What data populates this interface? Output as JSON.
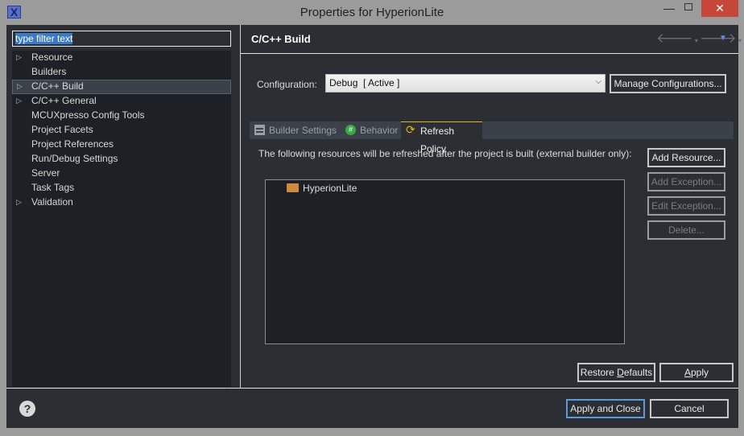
{
  "window": {
    "title": "Properties for HyperionLite",
    "app_icon": "x-window-icon",
    "close_color": "#c7463a"
  },
  "filter": {
    "value": "type filter text"
  },
  "tree": {
    "items": [
      {
        "label": "Resource",
        "expandable": true
      },
      {
        "label": "Builders",
        "expandable": false
      },
      {
        "label": "C/C++ Build",
        "expandable": true,
        "selected": true
      },
      {
        "label": "C/C++ General",
        "expandable": true
      },
      {
        "label": "MCUXpresso Config Tools",
        "expandable": false
      },
      {
        "label": "Project Facets",
        "expandable": false
      },
      {
        "label": "Project References",
        "expandable": false
      },
      {
        "label": "Run/Debug Settings",
        "expandable": false
      },
      {
        "label": "Server",
        "expandable": false
      },
      {
        "label": "Task Tags",
        "expandable": false
      },
      {
        "label": "Validation",
        "expandable": true
      }
    ]
  },
  "page": {
    "title": "C/C++ Build"
  },
  "config": {
    "label": "Configuration:",
    "selected": "Debug  [ Active ]",
    "manage_label": "Manage Configurations..."
  },
  "tabs": [
    {
      "label": "Builder Settings",
      "icon": "builder-settings-icon"
    },
    {
      "label": "Behavior",
      "icon": "behavior-icon"
    },
    {
      "label": "Refresh Policy",
      "icon": "refresh-icon",
      "active": true
    }
  ],
  "refresh": {
    "description": "The following resources will be refreshed after the project is built (external builder only):",
    "resources": [
      "HyperionLite"
    ],
    "add_resource": "Add Resource...",
    "add_exception": "Add Exception...",
    "edit_exception": "Edit Exception...",
    "delete": "Delete..."
  },
  "buttons": {
    "restore_pre": "Restore ",
    "restore_u": "D",
    "restore_post": "efaults",
    "apply_u": "A",
    "apply_post": "pply",
    "apply_close": "Apply and Close",
    "cancel": "Cancel"
  },
  "colors": {
    "accent_tab": "#e6b400",
    "folder": "#d08a3c",
    "selection": "#3a78c8"
  }
}
